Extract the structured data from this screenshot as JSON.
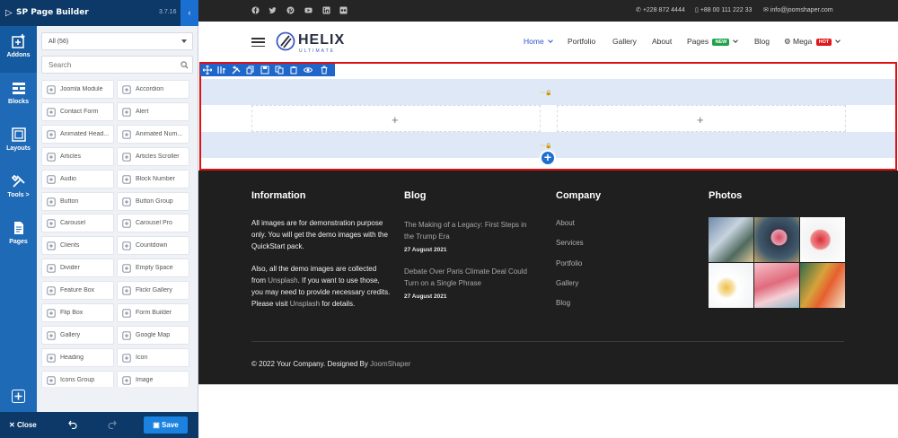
{
  "builder": {
    "title": "SP Page Builder",
    "version": "3.7.16",
    "rail": [
      {
        "label": "Addons",
        "icon": "add-box-icon"
      },
      {
        "label": "Blocks",
        "icon": "blocks-icon"
      },
      {
        "label": "Layouts",
        "icon": "layouts-icon"
      },
      {
        "label": "Tools >",
        "icon": "tools-icon"
      },
      {
        "label": "Pages",
        "icon": "pages-icon"
      }
    ],
    "filter": "All (56)",
    "search_placeholder": "Search",
    "addons": [
      {
        "label": "Joomla Module",
        "icon": "joomla-icon"
      },
      {
        "label": "Accordion",
        "icon": "accordion-icon"
      },
      {
        "label": "Contact Form",
        "icon": "contact-form-icon"
      },
      {
        "label": "Alert",
        "icon": "alert-icon"
      },
      {
        "label": "Animated Head...",
        "icon": "animated-heading-icon"
      },
      {
        "label": "Animated Num...",
        "icon": "animated-number-icon"
      },
      {
        "label": "Articles",
        "icon": "articles-icon"
      },
      {
        "label": "Articles Scroller",
        "icon": "articles-scroller-icon"
      },
      {
        "label": "Audio",
        "icon": "audio-icon"
      },
      {
        "label": "Block Number",
        "icon": "block-number-icon"
      },
      {
        "label": "Button",
        "icon": "button-icon"
      },
      {
        "label": "Button Group",
        "icon": "button-group-icon"
      },
      {
        "label": "Carousel",
        "icon": "carousel-icon"
      },
      {
        "label": "Carousel Pro",
        "icon": "carousel-pro-icon"
      },
      {
        "label": "Clients",
        "icon": "clients-icon"
      },
      {
        "label": "Countdown",
        "icon": "countdown-icon"
      },
      {
        "label": "Divider",
        "icon": "divider-icon"
      },
      {
        "label": "Empty Space",
        "icon": "empty-space-icon"
      },
      {
        "label": "Feature Box",
        "icon": "feature-box-icon"
      },
      {
        "label": "Flickr Gallery",
        "icon": "flickr-icon"
      },
      {
        "label": "Flip Box",
        "icon": "flip-box-icon"
      },
      {
        "label": "Form Builder",
        "icon": "form-builder-icon"
      },
      {
        "label": "Gallery",
        "icon": "gallery-icon"
      },
      {
        "label": "Google Map",
        "icon": "map-icon"
      },
      {
        "label": "Heading",
        "icon": "heading-icon"
      },
      {
        "label": "Icon",
        "icon": "heart-icon"
      },
      {
        "label": "Icons Group",
        "icon": "icons-group-icon"
      },
      {
        "label": "Image",
        "icon": "image-icon"
      }
    ],
    "footer": {
      "close": "Close",
      "save": "Save"
    }
  },
  "site": {
    "contact": {
      "phone1": "+228 872 4444",
      "phone2": "+88 00 111 222 33",
      "email": "info@joomshaper.com"
    },
    "brand": {
      "name": "HELIX",
      "sub": "ULTIMATE"
    },
    "nav": [
      {
        "label": "Home",
        "active": true,
        "chevron": true,
        "badge": ""
      },
      {
        "label": "Portfolio",
        "chevron": false,
        "badge": ""
      },
      {
        "label": "Gallery",
        "chevron": false,
        "badge": ""
      },
      {
        "label": "About",
        "chevron": false,
        "badge": ""
      },
      {
        "label": "Pages",
        "chevron": true,
        "badge": "NEW",
        "badge_color": "#1fa34a"
      },
      {
        "label": "Blog",
        "chevron": false,
        "badge": ""
      },
      {
        "label": "Mega",
        "chevron": true,
        "badge": "HOT",
        "badge_color": "#e0161b"
      }
    ],
    "footer": {
      "information": {
        "heading": "Information",
        "p1": "All images are for demonstration purpose only. You will get the demo images with the QuickStart pack.",
        "p2_a": "Also, all the demo images are collected from ",
        "p2_link": "Unsplash",
        "p2_b": ". If you want to use those, you may need to provide necessary credits. Please visit ",
        "p2_link2": "Unsplash",
        "p2_c": " for details."
      },
      "blog": {
        "heading": "Blog",
        "posts": [
          {
            "title": "The Making of a Legacy: First Steps in the Trump Era",
            "date": "27 August 2021"
          },
          {
            "title": "Debate Over Paris Climate Deal Could Turn on a Single Phrase",
            "date": "27 August 2021"
          }
        ]
      },
      "company": {
        "heading": "Company",
        "links": [
          "About",
          "Services",
          "Portfolio",
          "Gallery",
          "Blog"
        ]
      },
      "photos": {
        "heading": "Photos"
      },
      "copyright": "© 2022 Your Company. Designed By ",
      "copyright_link": "JoomShaper"
    }
  },
  "colors": {
    "builder_dark": "#0c3967",
    "rail": "#1f6ab6",
    "accent": "#1b82e0",
    "selection": "#e10f0f",
    "footer_bg": "#1f1f1f"
  }
}
